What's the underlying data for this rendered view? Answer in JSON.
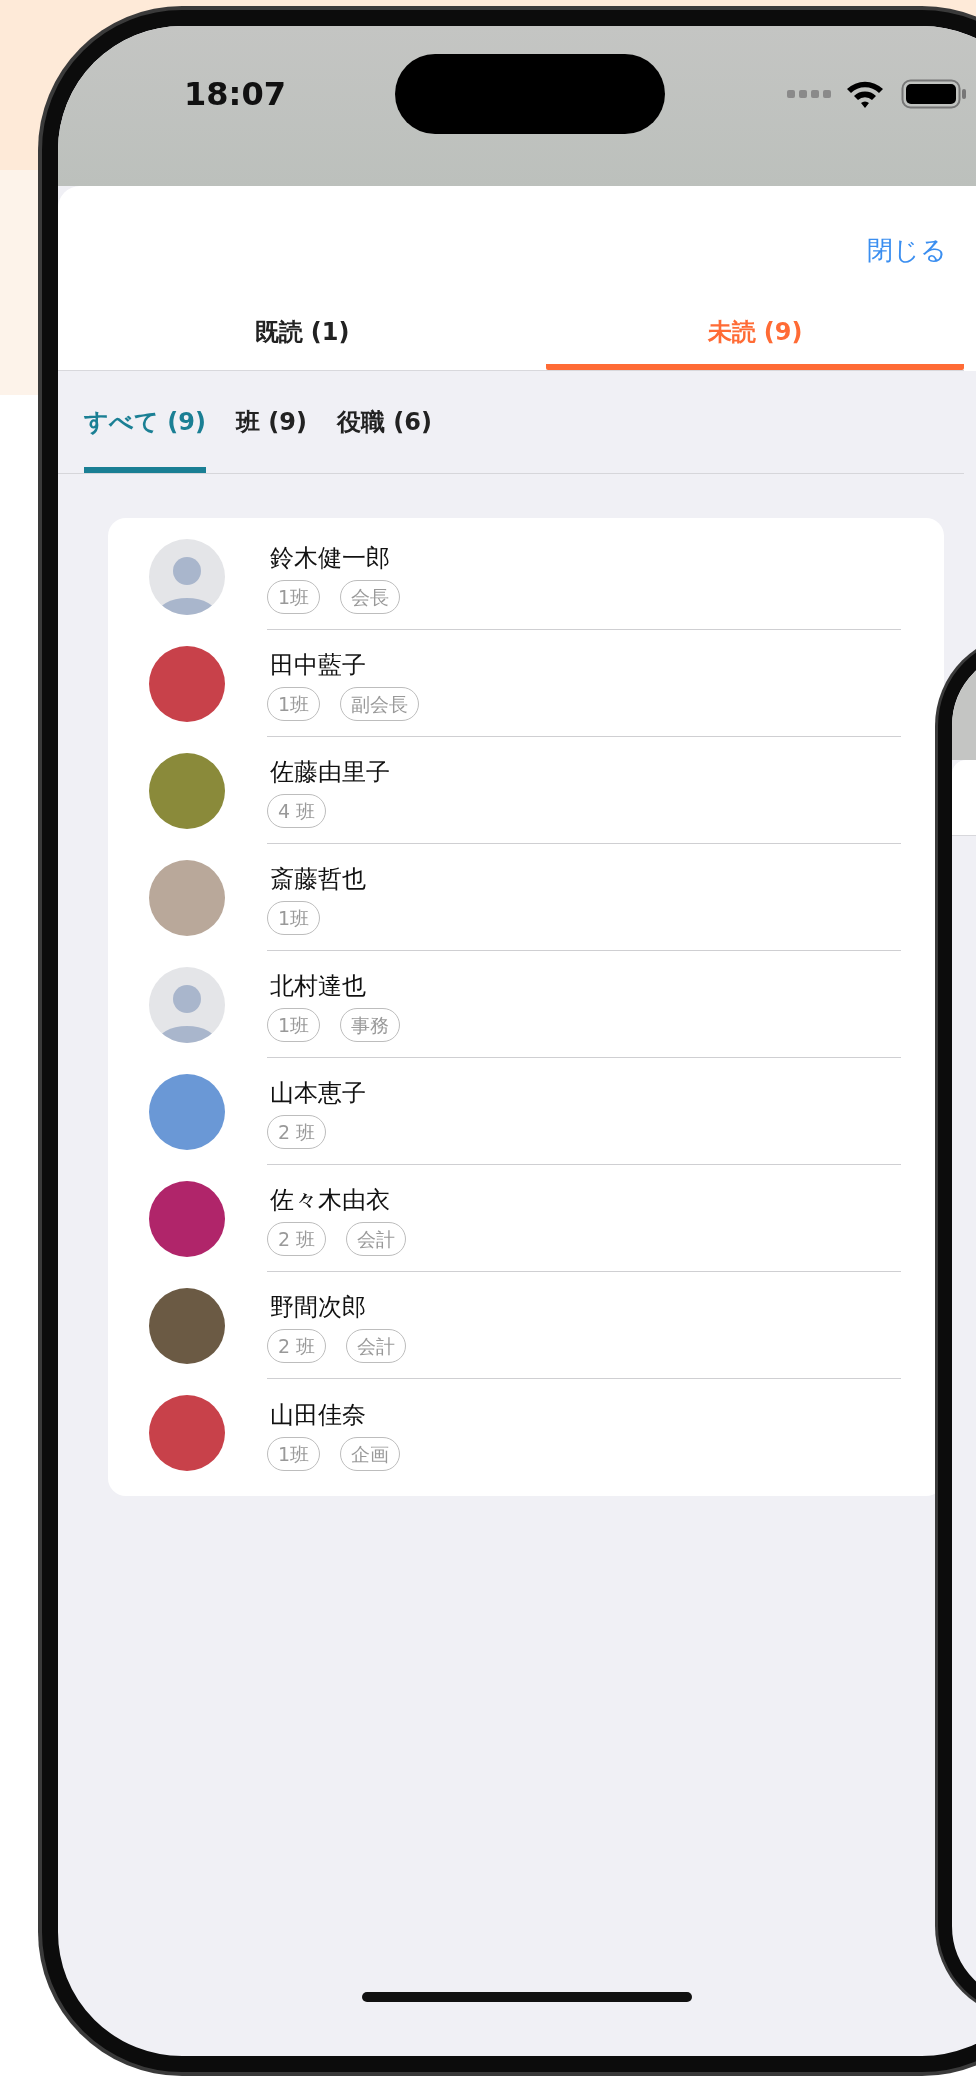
{
  "status_bar": {
    "time": "18:07"
  },
  "sheet": {
    "close_button": "閉じる",
    "tabs": [
      {
        "label": "既読 (1)",
        "selected": false
      },
      {
        "label": "未読 (9)",
        "selected": true
      }
    ],
    "filters": [
      {
        "label": "すべて (9)",
        "selected": true
      },
      {
        "label": "班 (9)",
        "selected": false
      },
      {
        "label": "役職 (6)",
        "selected": false
      }
    ],
    "members": [
      {
        "kind": "default",
        "name": "鈴木健一郎",
        "tags": [
          "1班",
          "会長"
        ]
      },
      {
        "kind": "photo",
        "name": "田中藍子",
        "tags": [
          "1班",
          "副会長"
        ]
      },
      {
        "kind": "photo",
        "name": "佐藤由里子",
        "tags": [
          "4 班"
        ]
      },
      {
        "kind": "photo",
        "name": "斎藤哲也",
        "tags": [
          "1班"
        ]
      },
      {
        "kind": "default",
        "name": "北村達也",
        "tags": [
          "1班",
          "事務"
        ]
      },
      {
        "kind": "photo",
        "name": "山本恵子",
        "tags": [
          "2 班"
        ]
      },
      {
        "kind": "photo",
        "name": "佐々木由衣",
        "tags": [
          "2 班",
          "会計"
        ]
      },
      {
        "kind": "photo",
        "name": "野間次郎",
        "tags": [
          "2 班",
          "会計"
        ]
      },
      {
        "kind": "photo",
        "name": "山田佳奈",
        "tags": [
          "1班",
          "企画"
        ]
      }
    ]
  }
}
